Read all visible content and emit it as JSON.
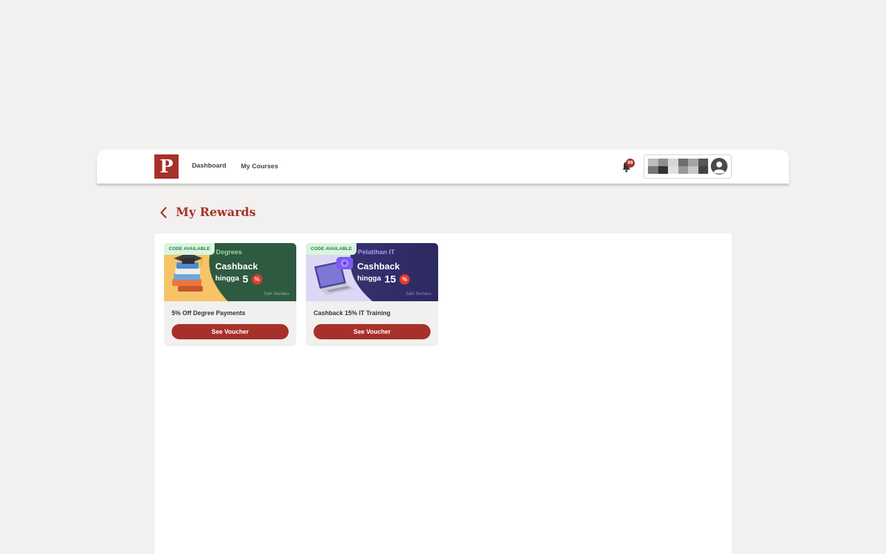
{
  "header": {
    "logo_letter": "P",
    "nav": [
      {
        "label": "Dashboard",
        "active": true
      },
      {
        "label": "My Courses",
        "active": false
      }
    ],
    "notification_count": "99",
    "brand_color": "#a8302a"
  },
  "page": {
    "title": "My Rewards",
    "back_icon": "chevron-left-icon"
  },
  "vouchers": [
    {
      "tag": "CODE AVAILABLE",
      "category": "Degrees",
      "headline": "Cashback",
      "prefix": "hingga",
      "amount": "5",
      "percent_symbol": "%",
      "terms": "S&K Berlaku",
      "title": "5% Off Degree Payments",
      "button_label": "See Voucher",
      "banner_color": "#2e5a40",
      "accent_color": "#f6c467"
    },
    {
      "tag": "CODE AVAILABLE",
      "category": "Pelatihan IT",
      "headline": "Cashback",
      "prefix": "hingga",
      "amount": "15",
      "percent_symbol": "%",
      "terms": "S&K Berlaku",
      "title": "Cashback 15% IT Training",
      "button_label": "See Voucher",
      "banner_color": "#34306a",
      "accent_color": "#dcd7f5"
    }
  ]
}
